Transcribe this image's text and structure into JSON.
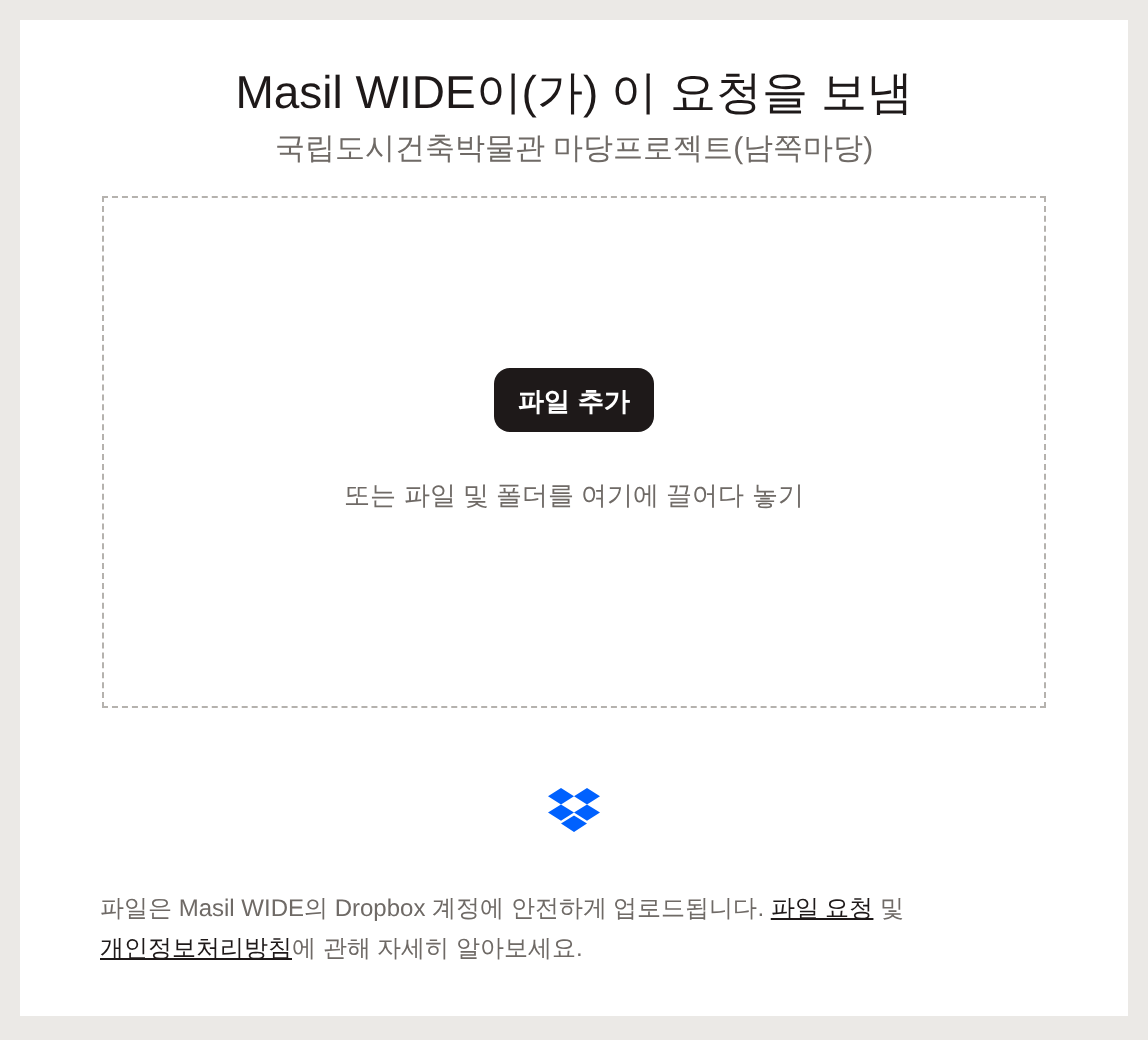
{
  "title": "Masil WIDE이(가) 이 요청을 보냄",
  "subtitle": "국립도시건축박물관 마당프로젝트(남쪽마당)",
  "dropzone": {
    "button": "파일 추가",
    "hint": "또는 파일 및 폴더를 여기에 끌어다 놓기"
  },
  "footer": {
    "text_before": "파일은 Masil WIDE의 Dropbox 계정에 안전하게 업로드됩니다.",
    "link_1": "파일 요청",
    "text_middle": "및",
    "link_2": "개인정보처리방침",
    "text_after": "에 관해 자세히 알아보세요."
  }
}
